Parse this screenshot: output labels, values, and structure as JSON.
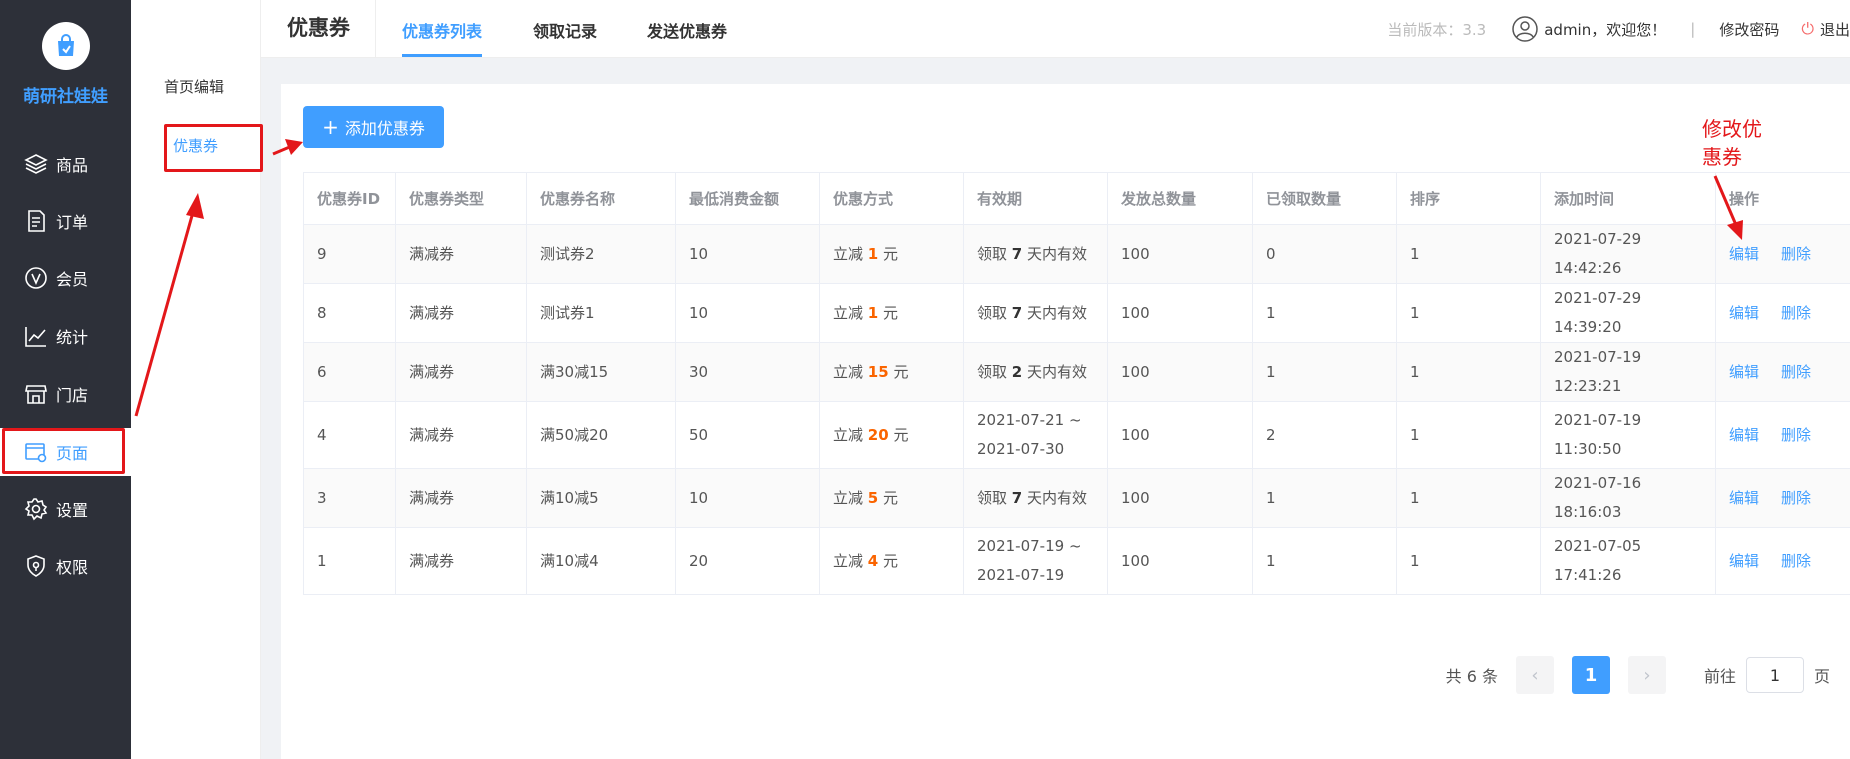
{
  "app": {
    "name": "萌研社娃娃"
  },
  "sidebar": {
    "items": [
      {
        "label": "商品",
        "icon": "layers-icon",
        "active": false
      },
      {
        "label": "订单",
        "icon": "document-icon",
        "active": false
      },
      {
        "label": "会员",
        "icon": "vip-icon",
        "active": false
      },
      {
        "label": "统计",
        "icon": "chart-line-icon",
        "active": false
      },
      {
        "label": "门店",
        "icon": "store-icon",
        "active": false
      },
      {
        "label": "页面",
        "icon": "page-settings-icon",
        "active": true
      },
      {
        "label": "设置",
        "icon": "gear-icon",
        "active": false
      },
      {
        "label": "权限",
        "icon": "shield-icon",
        "active": false
      }
    ]
  },
  "submenu": {
    "items": [
      {
        "label": "首页编辑",
        "active": false
      },
      {
        "label": "优惠券",
        "active": true
      }
    ]
  },
  "header": {
    "title": "优惠券",
    "tabs": [
      {
        "label": "优惠券列表",
        "active": true
      },
      {
        "label": "领取记录",
        "active": false
      },
      {
        "label": "发送优惠券",
        "active": false
      }
    ],
    "version": "当前版本：3.3",
    "welcome": "admin，欢迎您！",
    "separator": "|",
    "change_password": "修改密码",
    "logout": "退出"
  },
  "toolbar": {
    "add_label": "添加优惠券"
  },
  "table": {
    "columns": [
      "优惠券ID",
      "优惠券类型",
      "优惠券名称",
      "最低消费金额",
      "优惠方式",
      "有效期",
      "发放总数量",
      "已领取数量",
      "排序",
      "添加时间",
      "操作"
    ],
    "rows": [
      {
        "id": "9",
        "type": "满减券",
        "name": "测试券2",
        "min": "10",
        "disc_pre": "立减",
        "disc_val": "1",
        "disc_unit": "元",
        "valid_kind": "days",
        "valid_pre": "领取",
        "valid_val": "7",
        "valid_post": "天内有效",
        "valid_range": "",
        "total": "100",
        "claimed": "0",
        "sort": "1",
        "time": "2021-07-29 14:42:26",
        "edit": "编辑",
        "del": "删除"
      },
      {
        "id": "8",
        "type": "满减券",
        "name": "测试券1",
        "min": "10",
        "disc_pre": "立减",
        "disc_val": "1",
        "disc_unit": "元",
        "valid_kind": "days",
        "valid_pre": "领取",
        "valid_val": "7",
        "valid_post": "天内有效",
        "valid_range": "",
        "total": "100",
        "claimed": "1",
        "sort": "1",
        "time": "2021-07-29 14:39:20",
        "edit": "编辑",
        "del": "删除"
      },
      {
        "id": "6",
        "type": "满减券",
        "name": "满30减15",
        "min": "30",
        "disc_pre": "立减",
        "disc_val": "15",
        "disc_unit": "元",
        "valid_kind": "days",
        "valid_pre": "领取",
        "valid_val": "2",
        "valid_post": "天内有效",
        "valid_range": "",
        "total": "100",
        "claimed": "1",
        "sort": "1",
        "time": "2021-07-19 12:23:21",
        "edit": "编辑",
        "del": "删除"
      },
      {
        "id": "4",
        "type": "满减券",
        "name": "满50减20",
        "min": "50",
        "disc_pre": "立减",
        "disc_val": "20",
        "disc_unit": "元",
        "valid_kind": "range",
        "valid_pre": "",
        "valid_val": "",
        "valid_post": "",
        "valid_range": "2021-07-21 ~ 2021-07-30",
        "total": "100",
        "claimed": "2",
        "sort": "1",
        "time": "2021-07-19 11:30:50",
        "edit": "编辑",
        "del": "删除"
      },
      {
        "id": "3",
        "type": "满减券",
        "name": "满10减5",
        "min": "10",
        "disc_pre": "立减",
        "disc_val": "5",
        "disc_unit": "元",
        "valid_kind": "days",
        "valid_pre": "领取",
        "valid_val": "7",
        "valid_post": "天内有效",
        "valid_range": "",
        "total": "100",
        "claimed": "1",
        "sort": "1",
        "time": "2021-07-16 18:16:03",
        "edit": "编辑",
        "del": "删除"
      },
      {
        "id": "1",
        "type": "满减券",
        "name": "满10减4",
        "min": "20",
        "disc_pre": "立减",
        "disc_val": "4",
        "disc_unit": "元",
        "valid_kind": "range",
        "valid_pre": "",
        "valid_val": "",
        "valid_post": "",
        "valid_range": "2021-07-19 ~ 2021-07-19",
        "total": "100",
        "claimed": "1",
        "sort": "1",
        "time": "2021-07-05 17:41:26",
        "edit": "编辑",
        "del": "删除"
      }
    ]
  },
  "pagination": {
    "total": "共 6 条",
    "prev": "‹",
    "current": "1",
    "next": "›",
    "goto_label": "前往",
    "goto_value": "1",
    "page_suffix": "页"
  },
  "annotation": {
    "text_line1": "修改优",
    "text_line2": "惠券",
    "color": "#e3171a"
  },
  "colors": {
    "accent": "#409eff",
    "sidebar_bg": "#2d3039",
    "highlight": "#fa6400"
  }
}
